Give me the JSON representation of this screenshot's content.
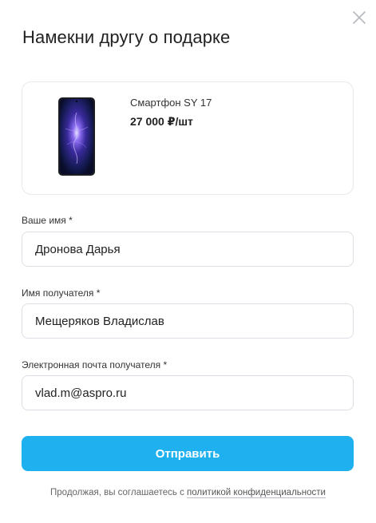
{
  "dialog": {
    "title": "Намекни другу о подарке"
  },
  "product": {
    "name": "Смартфон SY 17",
    "price": "27 000 ₽/шт"
  },
  "form": {
    "sender_name": {
      "label": "Ваше имя *",
      "value": "Дронова Дарья"
    },
    "recipient_name": {
      "label": "Имя получателя *",
      "value": "Мещеряков Владислав"
    },
    "recipient_email": {
      "label": "Электронная почта получателя *",
      "value": "vlad.m@aspro.ru"
    },
    "submit_label": "Отправить"
  },
  "consent": {
    "text": "Продолжая, вы соглашаетесь с ",
    "link_text": "политикой конфиденциальности"
  },
  "colors": {
    "accent": "#1fb1ef",
    "border": "#dcdfe5"
  },
  "icons": {
    "close": "close-icon",
    "product": "smartphone-image"
  }
}
